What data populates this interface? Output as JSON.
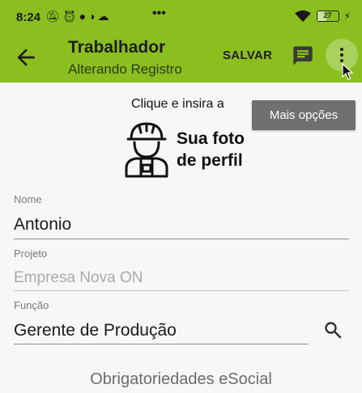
{
  "status_bar": {
    "time": "8:24",
    "notification_icons": [
      "mute-icon",
      "alarm-icon",
      "voicemail-icon",
      "nubank-icon",
      "cloud-icon"
    ],
    "overflow": "•••",
    "battery_level": "27"
  },
  "app_bar": {
    "title": "Trabalhador",
    "subtitle": "Alterando Registro",
    "save_label": "SALVAR",
    "background": "#8bbf1f"
  },
  "photo": {
    "hint": "Clique e insira a",
    "label_line1": "Sua foto",
    "label_line2": "de perfil",
    "more_options": "Mais opções"
  },
  "form": {
    "name_label": "Nome",
    "name_value": "Antonio",
    "project_label": "Projeto",
    "project_value": "Empresa Nova ON",
    "role_label": "Função",
    "role_value": "Gerente de Produção"
  },
  "section": {
    "title": "Obrigatoriedades eSocial"
  }
}
